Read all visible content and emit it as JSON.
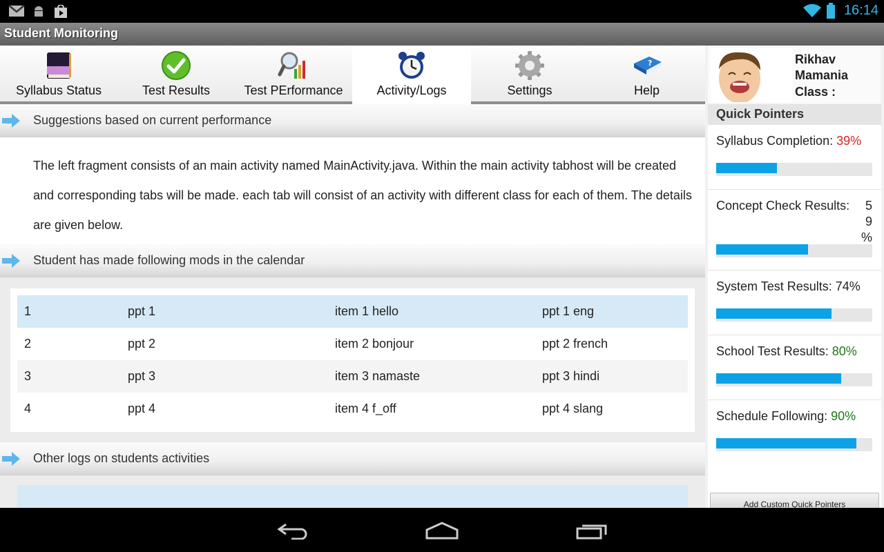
{
  "status_bar": {
    "time": "16:14"
  },
  "app": {
    "title": "Student Monitoring"
  },
  "tabs": [
    {
      "label": "Syllabus Status",
      "icon": "notebook-icon"
    },
    {
      "label": "Test Results",
      "icon": "check-icon"
    },
    {
      "label": "Test PErformance",
      "icon": "magnifier-chart-icon"
    },
    {
      "label": "Activity/Logs",
      "icon": "alarm-clock-icon",
      "active": true
    },
    {
      "label": "Settings",
      "icon": "gear-icon"
    },
    {
      "label": "Help",
      "icon": "help-book-icon"
    }
  ],
  "profile": {
    "first_name": "Rikhav",
    "last_name": "Mamania",
    "class_label": "Class :"
  },
  "sections": {
    "suggestions": {
      "title": "Suggestions based on current performance",
      "text": "The left fragment consists of an main activity named MainActivity.java. Within the main activity tabhost will be created and corresponding tabs will be made. each tab will consist of an activity with different class for each of them. The details are given below."
    },
    "mods": {
      "title": "Student has made following mods in the calendar",
      "rows": [
        [
          "1",
          "ppt 1",
          "item 1 hello",
          "ppt 1 eng"
        ],
        [
          "2",
          "ppt 2",
          "item 2 bonjour",
          "ppt 2 french"
        ],
        [
          "3",
          "ppt 3",
          "item 3 namaste",
          "ppt 3 hindi"
        ],
        [
          "4",
          "ppt 4",
          "item 4 f_off",
          "ppt 4 slang"
        ]
      ]
    },
    "logs": {
      "title": "Other logs on students activities"
    }
  },
  "quick_pointers": {
    "title": "Quick Pointers",
    "items": [
      {
        "label": "Syllabus Completion: ",
        "value": "39%",
        "fraction": 0.39,
        "color": "#e02020"
      },
      {
        "label": "Concept Check Results: ",
        "value": "59 %",
        "fraction": 0.59,
        "color": "#222222"
      },
      {
        "label": "System Test Results: ",
        "value": "74%",
        "fraction": 0.74,
        "color": "#222222"
      },
      {
        "label": "School Test Results: ",
        "value": "80%",
        "fraction": 0.8,
        "color": "#1a7a1a"
      },
      {
        "label": "Schedule Following: ",
        "value": "90%",
        "fraction": 0.9,
        "color": "#1a7a1a"
      }
    ],
    "add_button": "Add Custom Quick Pointers"
  },
  "colors": {
    "accent": "#33b5e5",
    "bar_fill": "#0ca2e5",
    "row_highlight": "#d5eaf6"
  }
}
